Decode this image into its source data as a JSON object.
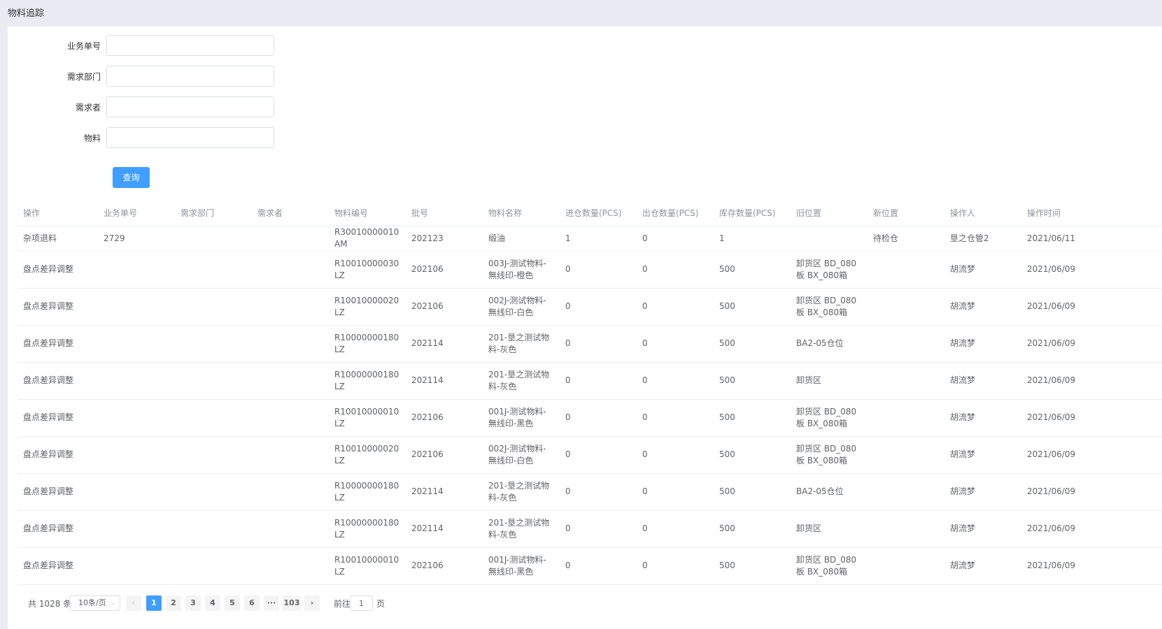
{
  "header": {
    "title": "物料追踪"
  },
  "form": {
    "fields": [
      {
        "label": "业务单号",
        "value": ""
      },
      {
        "label": "需求部门",
        "value": ""
      },
      {
        "label": "需求者",
        "value": ""
      },
      {
        "label": "物料",
        "value": ""
      }
    ],
    "query_label": "查询"
  },
  "table": {
    "columns": [
      "操作",
      "业务单号",
      "需求部门",
      "需求者",
      "物料编号",
      "批号",
      "物料名称",
      "进仓数量(PCS)",
      "出仓数量(PCS)",
      "库存数量(PCS)",
      "旧位置",
      "新位置",
      "操作人",
      "操作时间"
    ],
    "rows": [
      [
        "杂项退料",
        "2729",
        "",
        "",
        "R30010000010AM",
        "202123",
        "缎油",
        "1",
        "0",
        "1",
        "",
        "待检仓",
        "垦之仓管2",
        "2021/06/11"
      ],
      [
        "盘点差异调整",
        "",
        "",
        "",
        "R10010000030LZ",
        "202106",
        "003J-测试物料-無线印-橙色",
        "0",
        "0",
        "500",
        "卸货区 BD_080板 BX_080箱",
        "",
        "胡流梦",
        "2021/06/09"
      ],
      [
        "盘点差异调整",
        "",
        "",
        "",
        "R10010000020LZ",
        "202106",
        "002J-测试物料-無线印-白色",
        "0",
        "0",
        "500",
        "卸货区 BD_080板 BX_080箱",
        "",
        "胡流梦",
        "2021/06/09"
      ],
      [
        "盘点差异调整",
        "",
        "",
        "",
        "R10000000180LZ",
        "202114",
        "201-垦之测试物料-灰色",
        "0",
        "0",
        "500",
        "BA2-05仓位",
        "",
        "胡流梦",
        "2021/06/09"
      ],
      [
        "盘点差异调整",
        "",
        "",
        "",
        "R10000000180LZ",
        "202114",
        "201-垦之测试物料-灰色",
        "0",
        "0",
        "500",
        "卸货区",
        "",
        "胡流梦",
        "2021/06/09"
      ],
      [
        "盘点差异调整",
        "",
        "",
        "",
        "R10010000010LZ",
        "202106",
        "001J-测试物料-無线印-黑色",
        "0",
        "0",
        "500",
        "卸货区 BD_080板 BX_080箱",
        "",
        "胡流梦",
        "2021/06/09"
      ],
      [
        "盘点差异调整",
        "",
        "",
        "",
        "R10010000020LZ",
        "202106",
        "002J-测试物料-無线印-白色",
        "0",
        "0",
        "500",
        "卸货区 BD_080板 BX_080箱",
        "",
        "胡流梦",
        "2021/06/09"
      ],
      [
        "盘点差异调整",
        "",
        "",
        "",
        "R10000000180LZ",
        "202114",
        "201-垦之测试物料-灰色",
        "0",
        "0",
        "500",
        "BA2-05仓位",
        "",
        "胡流梦",
        "2021/06/09"
      ],
      [
        "盘点差异调整",
        "",
        "",
        "",
        "R10000000180LZ",
        "202114",
        "201-垦之测试物料-灰色",
        "0",
        "0",
        "500",
        "卸货区",
        "",
        "胡流梦",
        "2021/06/09"
      ],
      [
        "盘点差异调整",
        "",
        "",
        "",
        "R10010000010LZ",
        "202106",
        "001J-测试物料-無线印-黑色",
        "0",
        "0",
        "500",
        "卸货区 BD_080板 BX_080箱",
        "",
        "胡流梦",
        "2021/06/09"
      ]
    ]
  },
  "pagination": {
    "total_label": "共 1028 条",
    "page_size_label": "10条/页",
    "prev": "‹",
    "next": "›",
    "pages": [
      "1",
      "2",
      "3",
      "4",
      "5",
      "6",
      "···",
      "103"
    ],
    "current": "1",
    "goto_label": "前往",
    "goto_value": "1",
    "goto_unit": "页"
  },
  "colors": {
    "primary": "#409eff",
    "background": "#e9edf3"
  }
}
